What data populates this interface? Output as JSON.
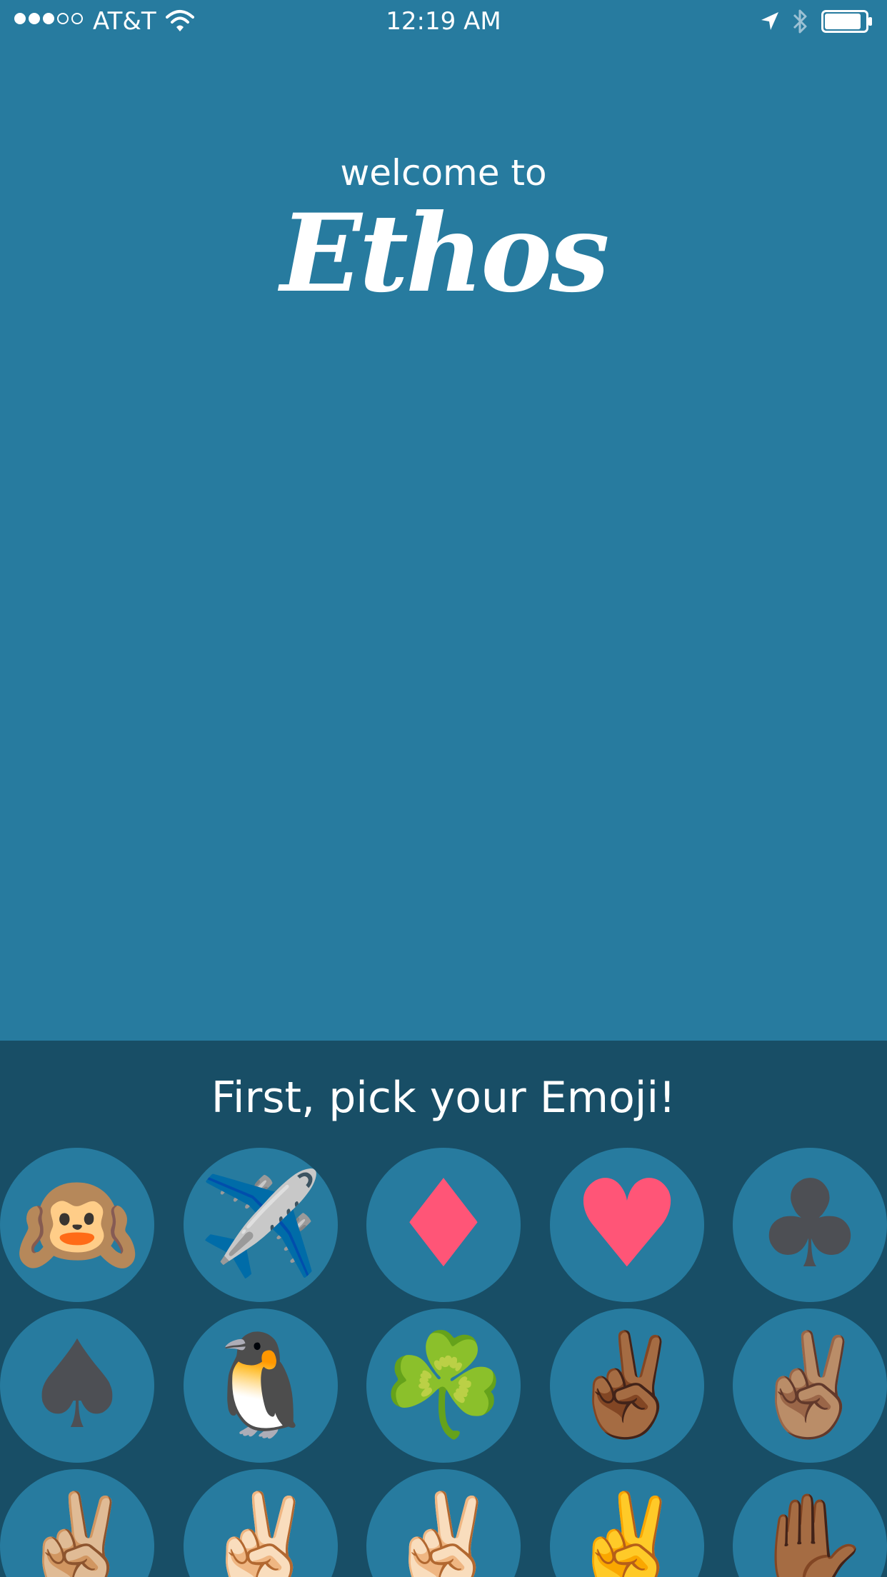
{
  "status_bar": {
    "carrier": "AT&T",
    "time": "12:19 AM",
    "signal_bars_filled": 3,
    "signal_bars_total": 5,
    "battery_level": 0.9
  },
  "header": {
    "welcome_text": "welcome to",
    "app_name": "Ethos"
  },
  "picker": {
    "title": "First, pick your Emoji!",
    "emojis": [
      {
        "glyph": "🙉",
        "name": "hear-no-evil-monkey"
      },
      {
        "glyph": "✈️",
        "name": "airplane"
      },
      {
        "glyph": "♦",
        "name": "diamond-suit",
        "color": "#ff5577"
      },
      {
        "glyph": "♥",
        "name": "heart-suit",
        "color": "#ff5577"
      },
      {
        "glyph": "♣",
        "name": "club-suit",
        "color": "#4d4f54"
      },
      {
        "glyph": "♠",
        "name": "spade-suit",
        "color": "#4d4f54"
      },
      {
        "glyph": "🐧",
        "name": "penguin"
      },
      {
        "glyph": "☘️",
        "name": "shamrock"
      },
      {
        "glyph": "✌🏾",
        "name": "victory-hand-medium-dark"
      },
      {
        "glyph": "✌🏽",
        "name": "victory-hand-medium"
      },
      {
        "glyph": "✌🏼",
        "name": "victory-hand-medium-light"
      },
      {
        "glyph": "✌🏻",
        "name": "victory-hand-light"
      },
      {
        "glyph": "✌🏻",
        "name": "victory-hand-lighter"
      },
      {
        "glyph": "✌️",
        "name": "victory-hand-yellow"
      },
      {
        "glyph": "✋🏾",
        "name": "raised-hand-dark"
      }
    ]
  },
  "colors": {
    "background": "#277b9f",
    "picker_background": "#184e66",
    "circle": "#277b9f",
    "suit_red": "#ff5577",
    "suit_dark": "#4d4f54"
  }
}
